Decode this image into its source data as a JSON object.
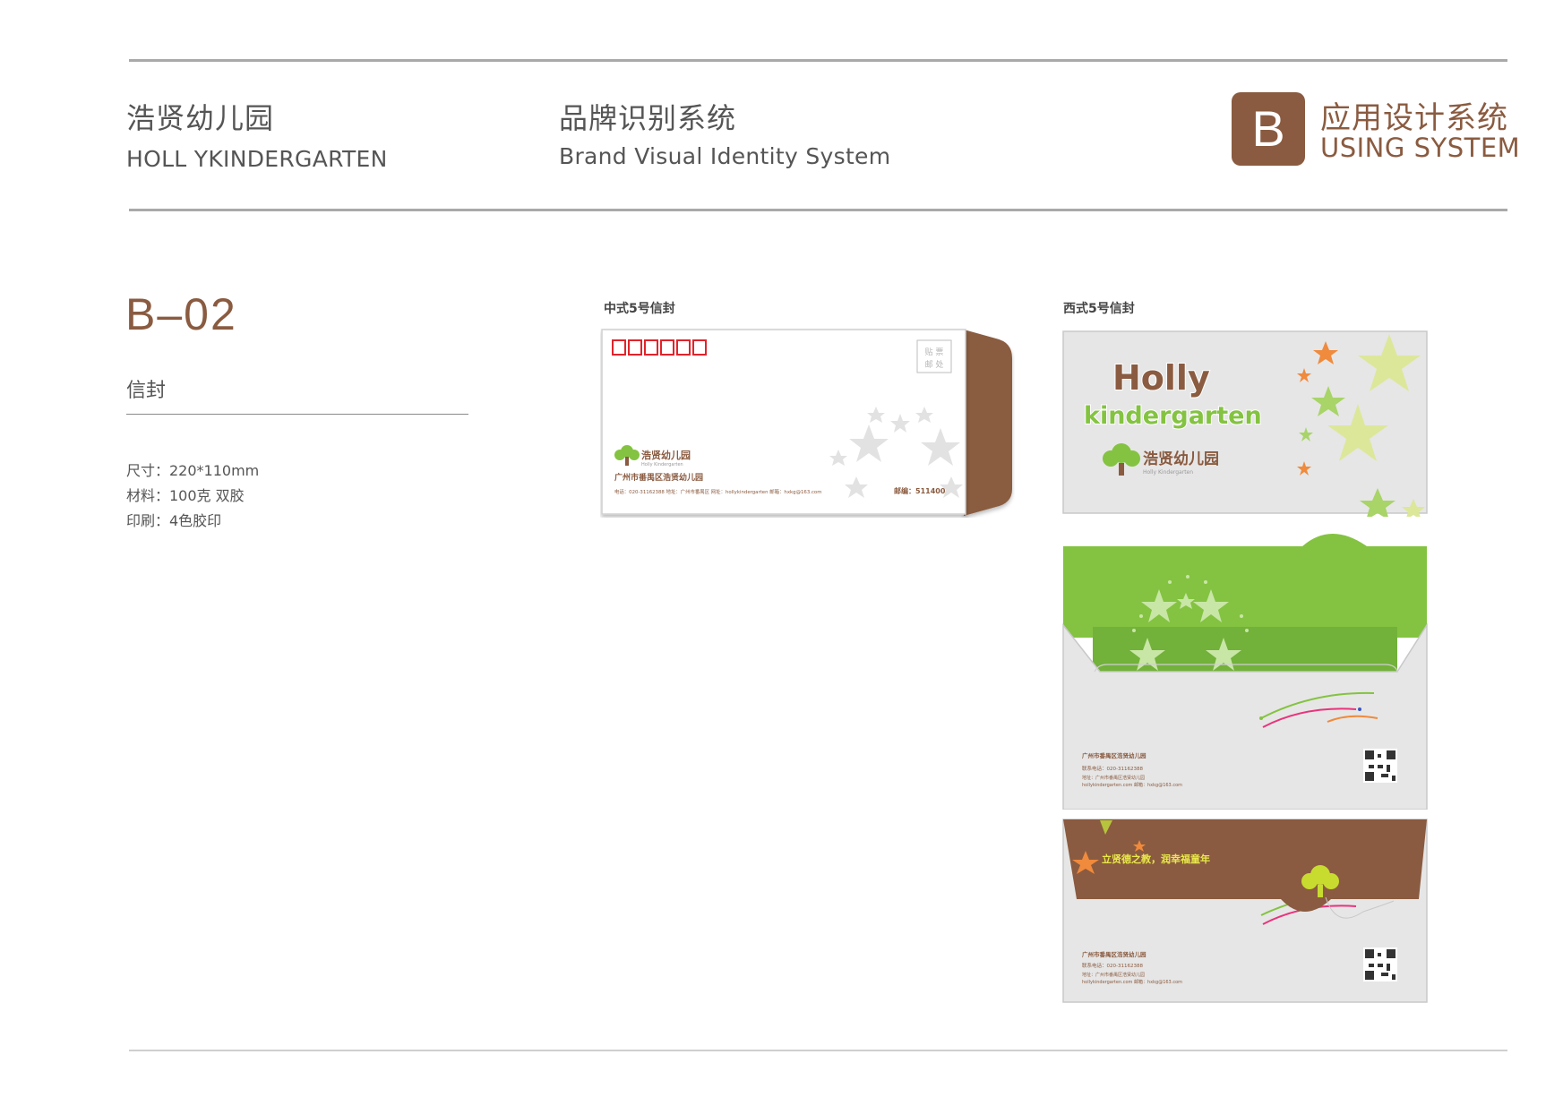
{
  "header": {
    "brand_cn": "浩贤幼儿园",
    "brand_en": "HOLL YKINDERGARTEN",
    "system_cn": "品牌识别系统",
    "system_en": "Brand Visual Identity System",
    "section_letter": "B",
    "section_cn": "应用设计系统",
    "section_en": "USING SYSTEM"
  },
  "item": {
    "code": "B–02",
    "name": "信封",
    "specs": [
      "尺寸：220*110mm",
      "材料：100克 双胶",
      "印刷：4色胶印"
    ]
  },
  "chinese_envelope": {
    "caption": "中式5号信封",
    "stamp_text": [
      "贴 票",
      "邮 处"
    ],
    "logo_text": "浩贤幼儿园",
    "logo_subtext": "Holly Kindergarten",
    "address": "广州市番禺区浩贤幼儿园",
    "contact_line": "电话：020-31162388  地址：广州市番禺区  网址：hollykindergarten  邮箱：hxkg@163.com",
    "postcode": "邮编：511400"
  },
  "western_envelope": {
    "caption": "西式5号信封",
    "logo_word1": "Holly",
    "logo_word2": "kindergarten",
    "logo_text": "浩贤幼儿园",
    "logo_subtext": "Holly Kindergarten",
    "address": "广州市番禺区浩贤幼儿园",
    "phone": "联系电话：020-31162388",
    "info_line": "地址：广州市番禺区浩贤幼儿园",
    "web_line": "hollykindergarten.com  邮箱：hxkg@163.com",
    "slogan": "立贤德之教，润幸福童年"
  },
  "colors": {
    "brand_brown": "#8a5b40",
    "brand_green": "#84c341",
    "brand_orange": "#f08a3c",
    "stamp_red": "#e0242b",
    "envelope_grey": "#e6e6e6"
  }
}
